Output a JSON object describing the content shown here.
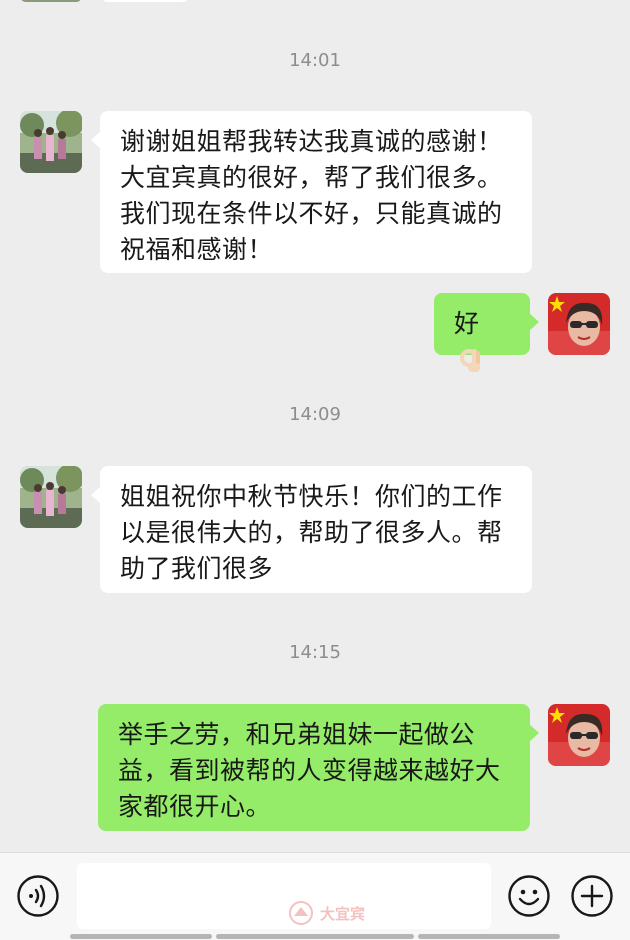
{
  "messages": [
    {
      "type": "timestamp",
      "text": "14:01"
    },
    {
      "type": "incoming",
      "sender": "contact",
      "text": "谢谢姐姐帮我转达我真诚的感谢！\n大宜宾真的很好，帮了我们很多。\n我们现在条件以不好，只能真诚的\n祝福和感谢！"
    },
    {
      "type": "outgoing",
      "sender": "me",
      "text": "好",
      "emoji": "ok-hand"
    },
    {
      "type": "timestamp",
      "text": "14:09"
    },
    {
      "type": "incoming",
      "sender": "contact",
      "text": "姐姐祝你中秋节快乐！你们的工作\n以是很伟大的，帮助了很多人。帮\n助了我们很多"
    },
    {
      "type": "timestamp",
      "text": "14:15"
    },
    {
      "type": "outgoing",
      "sender": "me",
      "text": "举手之劳，和兄弟姐妹一起做公\n益，看到被帮的人变得越来越好大\n家都很开心。"
    }
  ],
  "input_bar": {
    "placeholder": "",
    "icons": [
      "voice-icon",
      "emoji-icon",
      "plus-icon"
    ]
  },
  "watermark": {
    "text": "大宜宾"
  },
  "colors": {
    "background": "#ededed",
    "incoming_bubble": "#ffffff",
    "outgoing_bubble": "#95ec69",
    "timestamp_text": "#8d8d8d"
  }
}
